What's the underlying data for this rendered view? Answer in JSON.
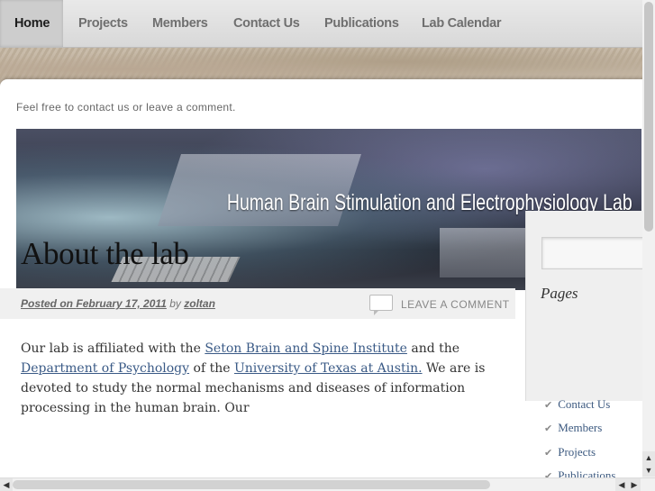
{
  "nav": {
    "items": [
      {
        "label": "Home",
        "active": true
      },
      {
        "label": "Projects"
      },
      {
        "label": "Members"
      },
      {
        "label": "Contact Us"
      },
      {
        "label": "Publications"
      },
      {
        "label": "Lab Calendar"
      }
    ]
  },
  "header": {
    "tagline": "Feel free to contact us or leave a comment.",
    "banner_title": "Human Brain Stimulation and Electrophysiology Lab"
  },
  "post": {
    "title": "About the lab",
    "meta": {
      "posted_on": "Posted on",
      "date": "February 17, 2011",
      "by": "by",
      "author": "zoltan"
    },
    "leave_comment": "LEAVE A COMMENT",
    "body": {
      "t1": "Our lab is affiliated with the ",
      "link1": "Seton Brain and Spine Institute",
      "t2": " and the ",
      "link2": "Department of Psychology",
      "t3": " of the ",
      "link3": "University of Texas at Austin.",
      "t4": " We are is devoted to study the normal mechanisms and diseases of information processing in the human brain. Our"
    }
  },
  "sidebar": {
    "pages_title": "Pages",
    "links": [
      "Contact Us",
      "Members",
      "Projects",
      "Publications"
    ]
  },
  "icons": {
    "comment": "speech-bubble-icon",
    "chevron": "double-chevron-icon",
    "scroll_left": "arrow-left-icon",
    "scroll_right": "arrow-right-icon",
    "scroll_up": "arrow-up-icon",
    "scroll_down": "arrow-down-icon"
  }
}
